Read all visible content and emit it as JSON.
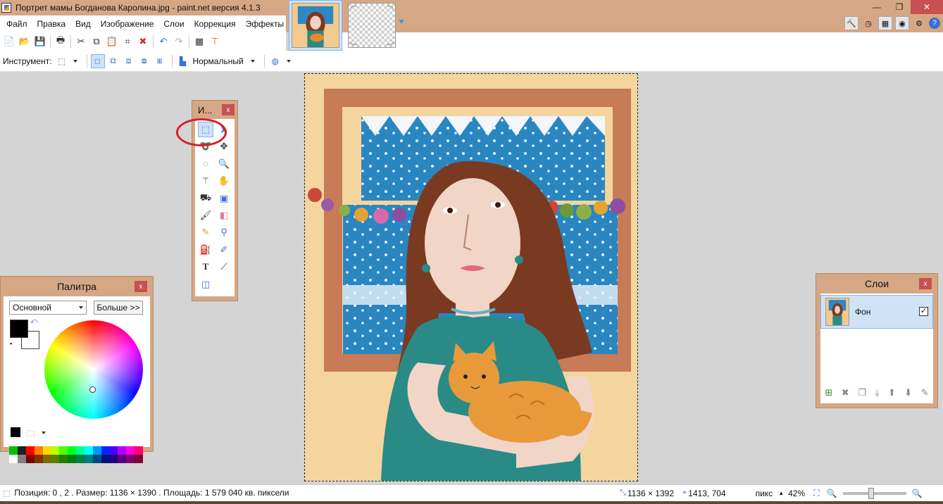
{
  "window": {
    "title": "Портрет мамы Богданова Каролина.jpg - paint.net версия 4.1.3",
    "minimize": "—",
    "maximize": "❐",
    "close": "✕"
  },
  "menu": [
    "Файл",
    "Правка",
    "Вид",
    "Изображение",
    "Слои",
    "Коррекция",
    "Эффекты"
  ],
  "optionsbar": {
    "tool_label": "Инструмент:",
    "blend_mode": "Нормальный"
  },
  "tools_window": {
    "title": "И...",
    "close": "x"
  },
  "palette": {
    "title": "Палитра",
    "close": "x",
    "mode": "Основной",
    "more_button": "Больше >>",
    "primary_color": "#000000",
    "secondary_color": "#ffffff"
  },
  "layers": {
    "title": "Слои",
    "close": "x",
    "layer_name": "Фон",
    "visible_mark": "✓"
  },
  "status": {
    "position": "Позиция: 0 , 2 . Размер: 1136  × 1390 . Площадь: 1 579 040 кв. пиксели",
    "image_size": "1136 × 1392",
    "cursor": "1413, 704",
    "units": "пикс",
    "zoom": "42%"
  },
  "colors": {
    "accent": "#d6a784",
    "selection": "#cfe3f7",
    "close_red": "#c75050",
    "highlight_ellipse": "#d71f26"
  },
  "icons": {
    "rect_select": "rectangle-select-icon",
    "move": "move-selection-icon",
    "lasso": "lasso-icon",
    "magic_wand": "magic-wand-icon",
    "zoom": "zoom-icon",
    "pan": "pan-icon",
    "bucket": "paint-bucket-icon",
    "gradient": "gradient-icon",
    "brush": "paintbrush-icon",
    "eraser": "eraser-icon",
    "pencil": "pencil-icon",
    "picker": "color-picker-icon",
    "clone": "clone-stamp-icon",
    "recolor": "recolor-icon",
    "text": "text-icon",
    "line": "line-curve-icon",
    "shapes": "shapes-icon"
  }
}
